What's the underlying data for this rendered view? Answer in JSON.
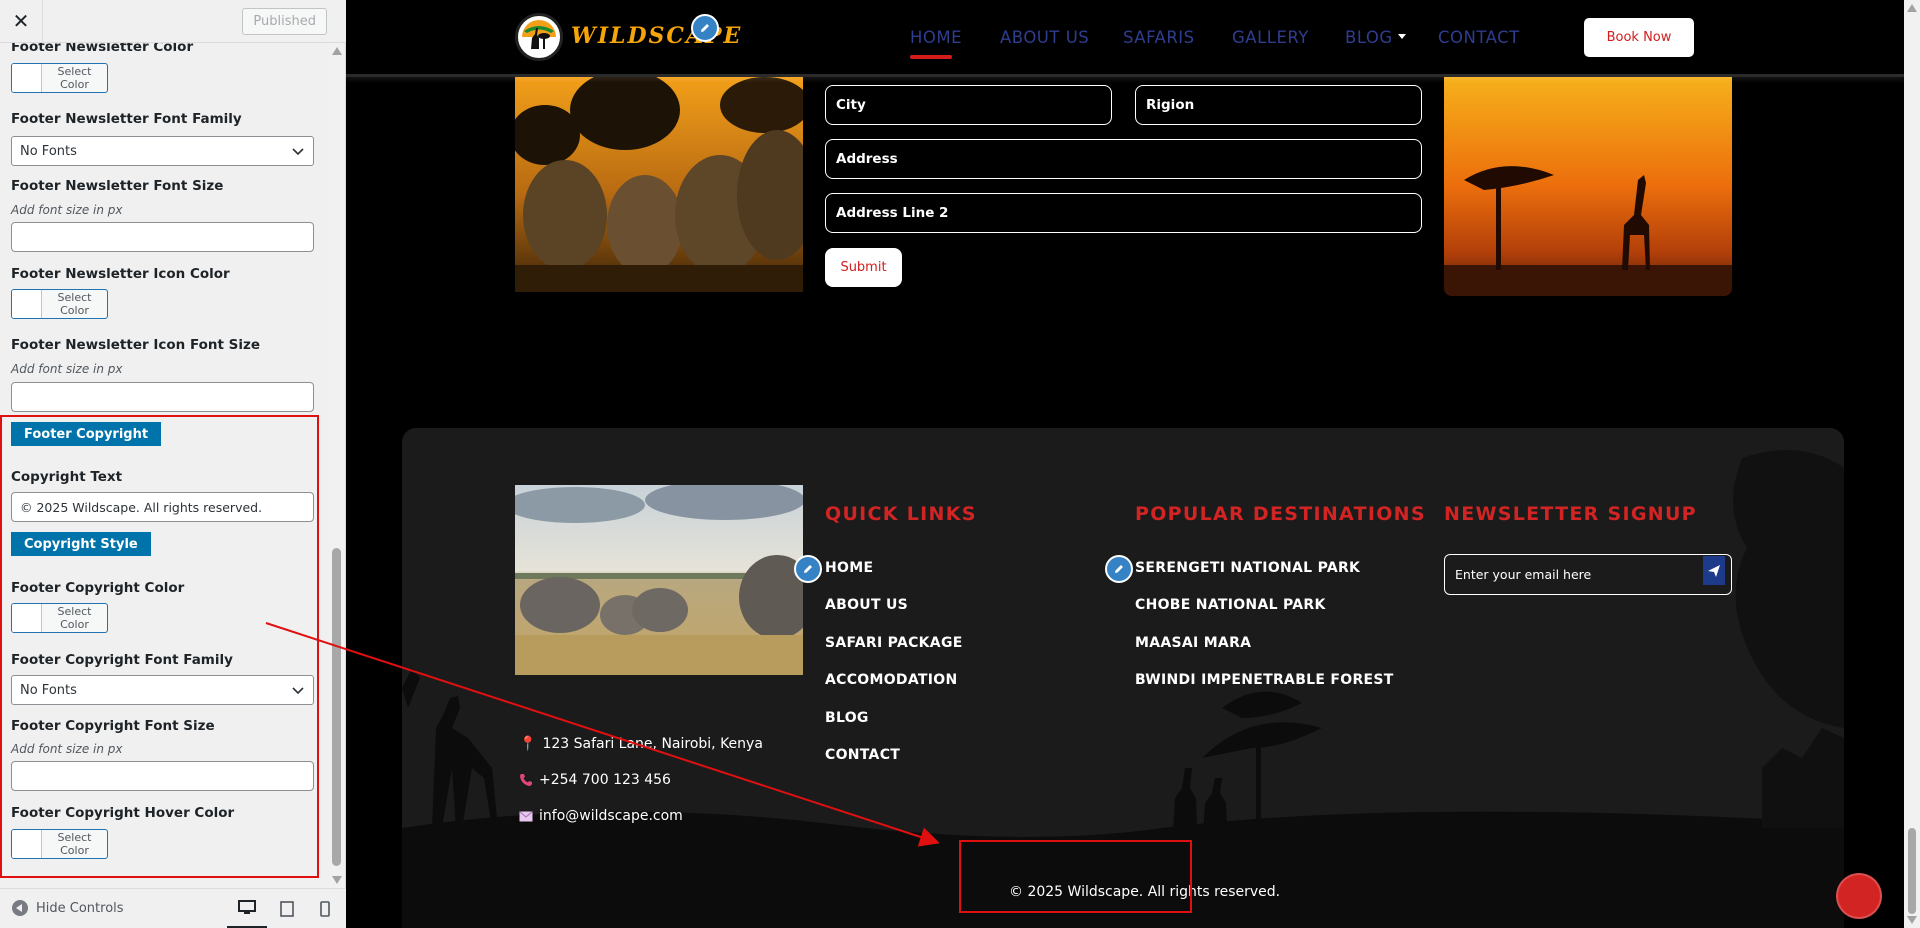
{
  "customizer": {
    "close_icon": "close-icon",
    "published_label": "Published",
    "controls": {
      "newsletter_color_title": "Footer Newsletter Color",
      "newsletter_font_family_title": "Footer Newsletter Font Family",
      "newsletter_font_family_value": "No Fonts",
      "newsletter_font_size_title": "Footer Newsletter Font Size",
      "newsletter_font_size_hint": "Add font size in px",
      "newsletter_icon_color_title": "Footer Newsletter Icon Color",
      "newsletter_icon_font_size_title": "Footer Newsletter Icon Font Size",
      "newsletter_icon_font_size_hint": "Add font size in px",
      "section_copyright_label": "Footer Copyright",
      "copyright_text_title": "Copyright Text",
      "copyright_text_value": "© 2025 Wildscape. All rights reserved.",
      "section_copyright_style_label": "Copyright Style",
      "copyright_color_title": "Footer Copyright Color",
      "copyright_font_family_title": "Footer Copyright Font Family",
      "copyright_font_family_value": "No Fonts",
      "copyright_font_size_title": "Footer Copyright Font Size",
      "copyright_font_size_hint": "Add font size in px",
      "copyright_hover_color_title": "Footer Copyright Hover Color"
    },
    "select_color_label": "Select Color",
    "hide_controls_label": "Hide Controls",
    "devices": [
      "desktop-icon",
      "tablet-icon",
      "mobile-icon"
    ]
  },
  "site": {
    "brand": "WILDSCAPE",
    "nav": [
      {
        "label": "HOME",
        "active": true
      },
      {
        "label": "ABOUT US"
      },
      {
        "label": "SAFARIS"
      },
      {
        "label": "GALLERY"
      },
      {
        "label": "BLOG"
      },
      {
        "label": "CONTACT"
      }
    ],
    "book_now": "Book Now",
    "form": {
      "city": "City",
      "region": "Rigion",
      "address": "Address",
      "address2": "Address Line 2",
      "submit": "Submit"
    },
    "footer": {
      "quick_links_heading": "QUICK LINKS",
      "quick_links": [
        "HOME",
        "ABOUT US",
        "SAFARI PACKAGE",
        "ACCOMODATION",
        "BLOG",
        "CONTACT"
      ],
      "destinations_heading": "POPULAR DESTINATIONS",
      "destinations": [
        "SERENGETI NATIONAL PARK",
        "CHOBE NATIONAL PARK",
        "MAASAI MARA",
        "BWINDI IMPENETRABLE FOREST"
      ],
      "newsletter_heading": "NEWSLETTER SIGNUP",
      "newsletter_placeholder": "Enter your email here",
      "address": "123 Safari Lane, Nairobi, Kenya",
      "phone": "+254 700 123 456",
      "email": "info@wildscape.com",
      "copyright": "© 2025 Wildscape. All rights reserved."
    }
  },
  "colors": {
    "accent_red": "#d32424",
    "wp_blue": "#0073aa",
    "nav_blue": "#2f3d8e",
    "brand_gold": "#f5a50a"
  }
}
